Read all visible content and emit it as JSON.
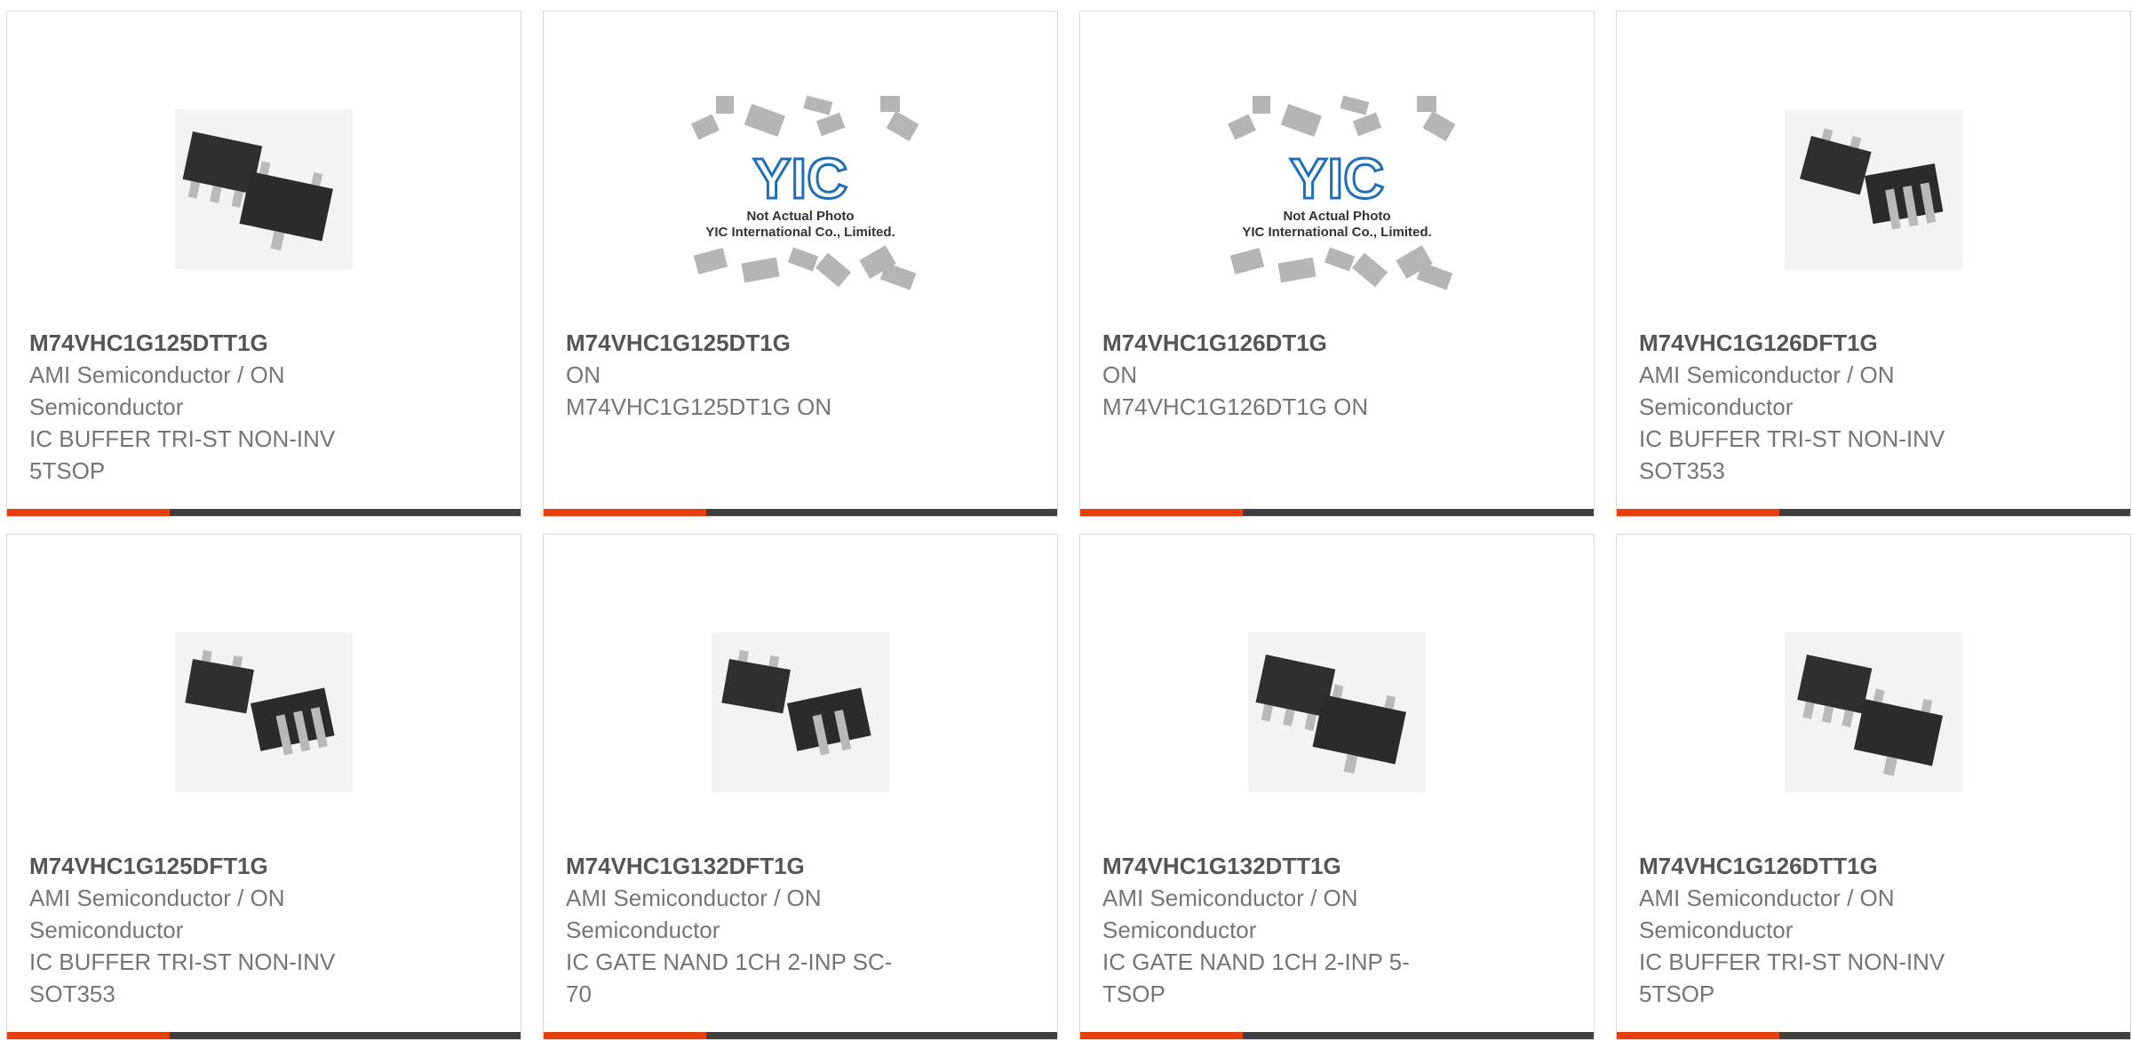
{
  "colors": {
    "accent": "#e8400c",
    "bar": "#3f3f3f",
    "border": "#d9d9d9",
    "text": "#757575"
  },
  "placeholder": {
    "line1": "Not Actual Photo",
    "line2": "YIC International Co., Limited."
  },
  "products": [
    {
      "part": "M74VHC1G125DTT1G",
      "mfr_line1": "AMI Semiconductor / ON",
      "mfr_line2": "Semiconductor",
      "desc_line1": "IC BUFFER TRI-ST NON-INV",
      "desc_line2": "5TSOP",
      "image": "sot23-5-chip-photo"
    },
    {
      "part": "M74VHC1G125DT1G",
      "mfr_line1": "ON",
      "mfr_line2": "M74VHC1G125DT1G ON",
      "desc_line1": "",
      "desc_line2": "",
      "image": "not-actual-photo"
    },
    {
      "part": "M74VHC1G126DT1G",
      "mfr_line1": "ON",
      "mfr_line2": "M74VHC1G126DT1G ON",
      "desc_line1": "",
      "desc_line2": "",
      "image": "not-actual-photo"
    },
    {
      "part": "M74VHC1G126DFT1G",
      "mfr_line1": "AMI Semiconductor / ON",
      "mfr_line2": "Semiconductor",
      "desc_line1": "IC BUFFER TRI-ST NON-INV",
      "desc_line2": "SOT353",
      "image": "sc70-5-chip-photo"
    },
    {
      "part": "M74VHC1G125DFT1G",
      "mfr_line1": "AMI Semiconductor / ON",
      "mfr_line2": "Semiconductor",
      "desc_line1": "IC BUFFER TRI-ST NON-INV",
      "desc_line2": "SOT353",
      "image": "sc70-5-chip-photo"
    },
    {
      "part": "M74VHC1G132DFT1G",
      "mfr_line1": "AMI Semiconductor / ON",
      "mfr_line2": "Semiconductor",
      "desc_line1": "IC GATE NAND 1CH 2-INP SC-",
      "desc_line2": "70",
      "image": "sc70-5-chip-photo"
    },
    {
      "part": "M74VHC1G132DTT1G",
      "mfr_line1": "AMI Semiconductor / ON",
      "mfr_line2": "Semiconductor",
      "desc_line1": "IC GATE NAND 1CH 2-INP 5-",
      "desc_line2": "TSOP",
      "image": "sot23-5-chip-photo"
    },
    {
      "part": "M74VHC1G126DTT1G",
      "mfr_line1": "AMI Semiconductor / ON",
      "mfr_line2": "Semiconductor",
      "desc_line1": "IC BUFFER TRI-ST NON-INV",
      "desc_line2": "5TSOP",
      "image": "sot23-5-chip-photo"
    }
  ]
}
